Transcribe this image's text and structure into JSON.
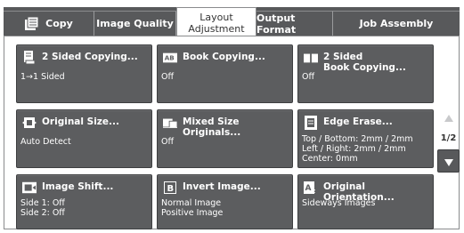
{
  "tabs": [
    {
      "label": "Copy",
      "icon": "copy-icon"
    },
    {
      "label": "Image Quality"
    },
    {
      "label": "Layout\nAdjustment",
      "active": true
    },
    {
      "label": "Output Format"
    },
    {
      "label": "Job Assembly"
    }
  ],
  "tiles": [
    {
      "title": "2 Sided Copying...",
      "value": "1→1 Sided",
      "icon": "two-sided-copy-icon"
    },
    {
      "title": "Book Copying...",
      "value": "Off",
      "icon": "book-copying-icon"
    },
    {
      "title": "2 Sided\nBook Copying...",
      "value": "Off",
      "icon": "two-sided-book-icon"
    },
    {
      "title": "Original Size...",
      "value": "Auto Detect",
      "icon": "original-size-icon"
    },
    {
      "title": "Mixed Size Originals...",
      "value": "Off",
      "icon": "mixed-size-icon"
    },
    {
      "title": "Edge Erase...",
      "value": "Top / Bottom: 2mm / 2mm\nLeft / Right: 2mm / 2mm\nCenter: 0mm",
      "icon": "edge-erase-icon"
    },
    {
      "title": "Image Shift...",
      "value": "Side 1: Off\nSide 2: Off",
      "icon": "image-shift-icon"
    },
    {
      "title": "Invert Image...",
      "value": "Normal Image\nPositive Image",
      "icon": "invert-image-icon"
    },
    {
      "title": "Original Orientation...",
      "value": "Sideways Images",
      "icon": "original-orientation-icon"
    }
  ],
  "pager": {
    "indicator": "1/2",
    "up_icon": "arrow-up-icon",
    "down_icon": "arrow-down-icon"
  },
  "colors": {
    "tab_bg": "#58595b",
    "tile_bg": "#5c5d5f",
    "text_light": "#ffffff"
  }
}
